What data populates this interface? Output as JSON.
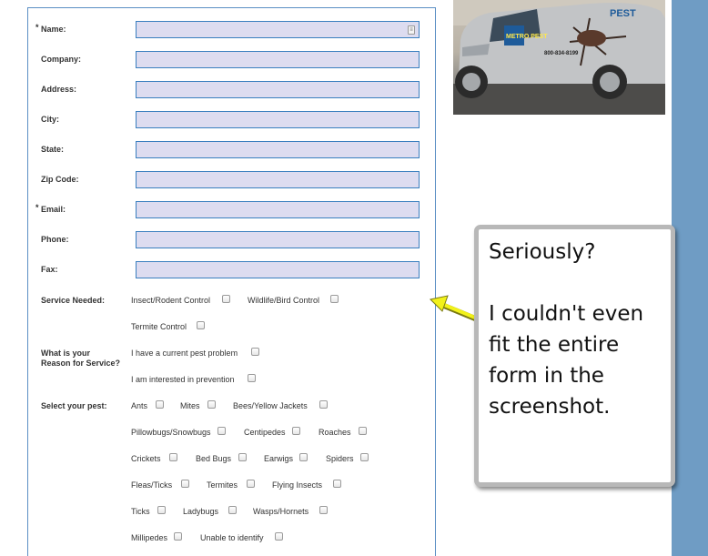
{
  "form": {
    "fields": [
      {
        "label": "Name:",
        "required": true,
        "value": ""
      },
      {
        "label": "Company:",
        "required": false,
        "value": ""
      },
      {
        "label": "Address:",
        "required": false,
        "value": ""
      },
      {
        "label": "City:",
        "required": false,
        "value": ""
      },
      {
        "label": "State:",
        "required": false,
        "value": ""
      },
      {
        "label": "Zip Code:",
        "required": false,
        "value": ""
      },
      {
        "label": "Email:",
        "required": true,
        "value": ""
      },
      {
        "label": "Phone:",
        "required": false,
        "value": ""
      },
      {
        "label": "Fax:",
        "required": false,
        "value": ""
      }
    ],
    "required_marker": "*",
    "service_needed": {
      "label": "Service Needed:",
      "options": [
        "Insect/Rodent Control",
        "Wildlife/Bird Control",
        "Termite Control"
      ]
    },
    "reason": {
      "label": "What is your Reason for Service?",
      "label_line1": "What is your",
      "label_line2": "Reason for Service?",
      "options": [
        "I have a current pest problem",
        "I am interested in prevention"
      ]
    },
    "pests": {
      "label": "Select your pest:",
      "options": [
        "Ants",
        "Mites",
        "Bees/Yellow Jackets",
        "Pillowbugs/Snowbugs",
        "Centipedes",
        "Roaches",
        "Crickets",
        "Bed Bugs",
        "Earwigs",
        "Spiders",
        "Fleas/Ticks",
        "Termites",
        "Flying Insects",
        "Ticks",
        "Ladybugs",
        "Wasps/Hornets",
        "Millipedes",
        "Unable to identify"
      ]
    }
  },
  "van_image": {
    "brand": "METRO PEST",
    "brand_word": "PEST",
    "phone": "800-834-8199"
  },
  "callout": {
    "line1": "Seriously?",
    "line2": "I couldn't even",
    "line3": "fit the entire",
    "line4": "form in the",
    "line5": "screenshot."
  },
  "colors": {
    "background": "#6f9cc4",
    "input_fill": "#dddcf0",
    "input_border": "#3a7fbf",
    "arrow": "#f2f21a"
  }
}
